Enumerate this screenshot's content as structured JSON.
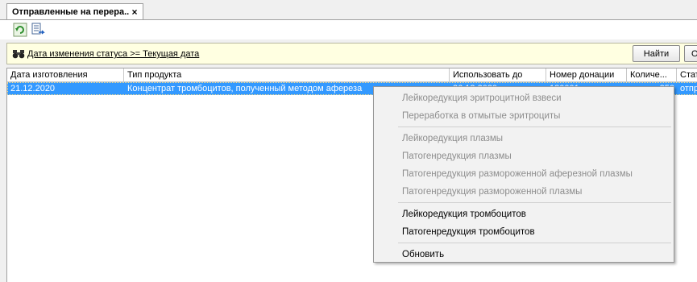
{
  "tab": {
    "title": "Отправленные на перера...",
    "close_glyph": "×"
  },
  "toolbar": {
    "buttons": [
      {
        "icon": "refresh-icon"
      },
      {
        "icon": "export-icon"
      }
    ]
  },
  "filter": {
    "icon": "binoculars-icon",
    "text": "Дата изменения статуса >=  Текущая дата",
    "find_button": "Найти",
    "clear_button": "О"
  },
  "grid": {
    "columns": [
      "Дата изготовления",
      "Тип продукта",
      "Использовать до",
      "Номер донации",
      "Количе...",
      "Стат"
    ],
    "rows": [
      {
        "date": "21.12.2020",
        "product": "Концентрат тромбоцитов, полученный методом афереза",
        "use_until": "26.12.2020",
        "donation": "180001",
        "qty": "250",
        "status": "отпр"
      }
    ]
  },
  "context_menu": {
    "items": [
      {
        "label": "Лейкоредукция эритроцитной взвеси",
        "enabled": false
      },
      {
        "label": "Переработка в отмытые эритроциты",
        "enabled": false
      },
      {
        "label": "Лейкоредукция плазмы",
        "enabled": false
      },
      {
        "label": "Патогенредукция плазмы",
        "enabled": false
      },
      {
        "label": "Патогенредукция размороженной аферезной плазмы",
        "enabled": false
      },
      {
        "label": "Патогенредукция размороженной плазмы",
        "enabled": false
      },
      {
        "label": "Лейкоредукция тромбоцитов",
        "enabled": true
      },
      {
        "label": "Патогенредукция тромбоцитов",
        "enabled": true
      },
      {
        "label": "Обновить",
        "enabled": true
      }
    ]
  }
}
